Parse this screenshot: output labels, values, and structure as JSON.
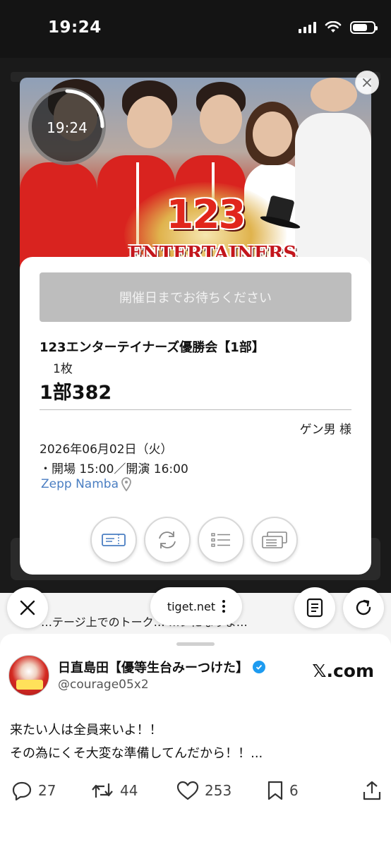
{
  "status_bar": {
    "time": "19:24"
  },
  "hero": {
    "logo_number": "123",
    "logo_text": "ENTERTAINERS",
    "timer": "19:24"
  },
  "ticket": {
    "wait_button": "開催日までお待ちください",
    "event_title": "123エンターテイナーズ優勝会【1部】",
    "quantity": "1枚",
    "seat": "1部382",
    "holder": "ゲン男 様",
    "date": "2026年06月02日（火）",
    "times": "・開場 15:00／開演 16:00",
    "venue": "Zepp Namba"
  },
  "browser": {
    "url": "tiget.net",
    "underlying_text": "…テージ上でのトーク…  …ンになりま…"
  },
  "tweet": {
    "author": "日直島田【優等生台みーつけた】",
    "username": "@courage05x2",
    "site": "𝕏.com",
    "line1": "来たい人は全員来いよ！！",
    "line2": "その為にくそ大変な準備してんだから！！...",
    "replies": "27",
    "retweets": "44",
    "likes": "253",
    "bookmarks": "6"
  },
  "colors": {
    "accent_blue": "#4a7ec2",
    "brand_red": "#d9231f",
    "verified": "#1d9bf0"
  }
}
